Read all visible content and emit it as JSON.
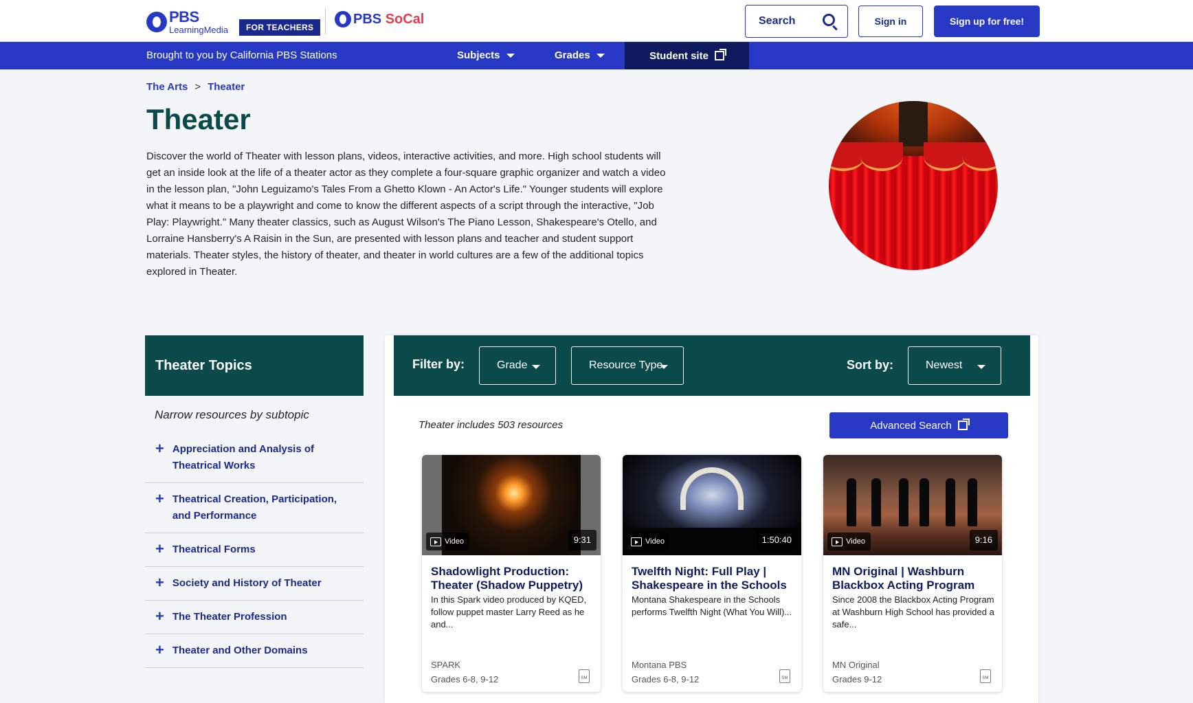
{
  "header": {
    "logo_top": "PBS",
    "logo_bottom": "LearningMedia",
    "for_teachers": "FOR TEACHERS",
    "station_logo_a": "PBS",
    "station_logo_b": "SoCal",
    "search_label": "Search",
    "signin_label": "Sign in",
    "signup_label": "Sign up for free!"
  },
  "nav": {
    "brought_by": "Brought to you by California PBS Stations",
    "subjects": "Subjects",
    "grades": "Grades",
    "student_site": "Student site"
  },
  "breadcrumb": {
    "parent": "The Arts",
    "separator": ">",
    "current": "Theater"
  },
  "hero": {
    "title": "Theater",
    "description": "Discover the world of Theater with lesson plans, videos, interactive activities, and more. High school students will get an inside look at the life of a theater actor as they complete a four-square graphic organizer and watch a video in the lesson plan, \"John Leguizamo's Tales From a Ghetto Klown - An Actor's Life.\" Younger students will explore what it means to be a playwright and come to know the different aspects of a script through the interactive, \"Job Play: Playwright.\" Many theater classics, such as August Wilson's The Piano Lesson, Shakespeare's Otello, and Lorraine Hansberry's A Raisin in the Sun, are presented with lesson plans and teacher and student support materials. Theater styles, the history of theater, and theater in world cultures are a few of the additional topics explored in Theater."
  },
  "sidebar": {
    "heading": "Theater Topics",
    "narrow": "Narrow resources by subtopic",
    "items": [
      {
        "label": "Appreciation and Analysis of Theatrical Works"
      },
      {
        "label": "Theatrical Creation, Participation, and Performance"
      },
      {
        "label": "Theatrical Forms"
      },
      {
        "label": "Society and History of Theater"
      },
      {
        "label": "The Theater Profession"
      },
      {
        "label": "Theater and Other Domains"
      }
    ]
  },
  "filters": {
    "filter_label": "Filter by:",
    "grade": "Grade",
    "resource_type": "Resource Type",
    "sort_label": "Sort by:",
    "sort_value": "Newest"
  },
  "results": {
    "count_text": "Theater includes 503 resources",
    "advanced_search": "Advanced Search"
  },
  "cards": [
    {
      "type": "Video",
      "duration": "9:31",
      "title": "Shadowlight Production: Theater (Shadow Puppetry)",
      "description": "In this Spark video produced by KQED, follow puppet master Larry Reed as he and...",
      "source": "SPARK",
      "grades": "Grades 6-8, 9-12"
    },
    {
      "type": "Video",
      "duration": "1:50:40",
      "title": "Twelfth Night: Full Play | Shakespeare in the Schools",
      "description": "Montana Shakespeare in the Schools performs Twelfth Night (What You Will)...",
      "source": "Montana PBS",
      "grades": "Grades 6-8, 9-12"
    },
    {
      "type": "Video",
      "duration": "9:16",
      "title": "MN Original | Washburn Blackbox Acting Program",
      "description": "Since 2008 the Blackbox Acting Program at Washburn High School has provided a safe...",
      "source": "MN Original",
      "grades": "Grades 9-12"
    }
  ],
  "doc_icon_text": "SM",
  "colors": {
    "brand_blue": "#2638c4",
    "dark_teal": "#0b4a4a",
    "navy": "#0f1a5e"
  }
}
